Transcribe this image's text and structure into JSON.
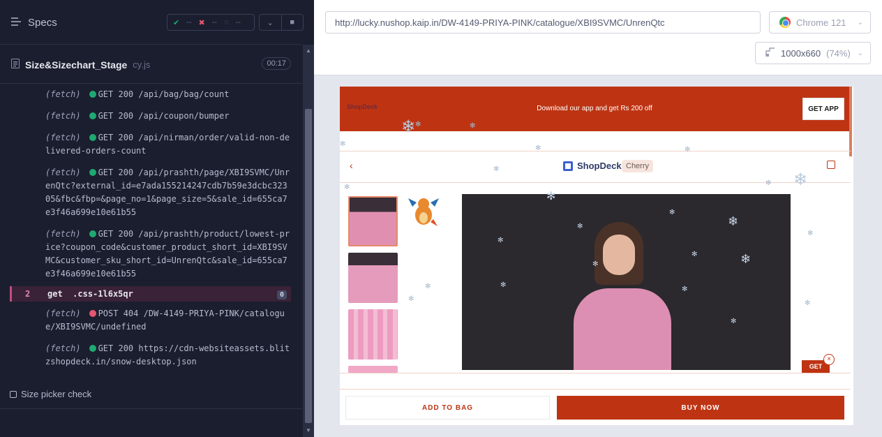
{
  "runner": {
    "specs_label": "Specs",
    "stats": {
      "passed": "--",
      "failed": "--",
      "pending": "--"
    },
    "spec_file": {
      "name": "Size&Sizechart_Stage",
      "ext": "cy.js",
      "duration": "00:17"
    },
    "log": [
      {
        "kind": "(fetch)",
        "status": "green",
        "text": "GET 200 /api/bag/bag/count"
      },
      {
        "kind": "(fetch)",
        "status": "green",
        "text": "GET 200 /api/coupon/bumper"
      },
      {
        "kind": "(fetch)",
        "status": "green",
        "text": "GET 200 /api/nirman/order/valid-non-delivered-orders-count"
      },
      {
        "kind": "(fetch)",
        "status": "green",
        "text": "GET 200 /api/prashth/page/XBI9SVMC/UnrenQtc?external_id=e7ada155214247cdb7b59e3dcbc32305&fbc&fbp=&page_no=1&page_size=5&sale_id=655ca7e3f46a699e10e61b55"
      },
      {
        "kind": "(fetch)",
        "status": "green",
        "text": "GET 200 /api/prashth/product/lowest-price?coupon_code&customer_product_short_id=XBI9SVMC&customer_sku_short_id=UnrenQtc&sale_id=655ca7e3f46a699e10e61b55"
      }
    ],
    "command": {
      "num": "2",
      "name": "get",
      "selector": ".css-1l6x5qr",
      "count": "0"
    },
    "log_after": [
      {
        "kind": "(fetch)",
        "status": "red",
        "text": "POST 404 /DW-4149-PRIYA-PINK/catalogue/XBI9SVMC/undefined"
      },
      {
        "kind": "(fetch)",
        "status": "green",
        "text": "GET 200 https://cdn-websiteassets.blitzshopdeck.in/snow-desktop.json"
      }
    ],
    "next_test": "Size picker check"
  },
  "browser": {
    "url": "http://lucky.nushop.kaip.in/DW-4149-PRIYA-PINK/catalogue/XBI9SVMC/UnrenQtc",
    "name": "Chrome 121",
    "viewport": "1000x660",
    "zoom": "(74%)"
  },
  "app": {
    "banner_logo": "ShopDeck",
    "banner_text": "Download our app and get Rs 200 off",
    "get_app": "GET APP",
    "brand": "ShopDeck",
    "store_pill": "Cherry",
    "float_badge": "GET",
    "add_to_bag": "ADD TO BAG",
    "buy_now": "BUY NOW"
  },
  "colors": {
    "brand": "#be3413",
    "runner_bg": "#1b1e2e",
    "pass": "#1fa971",
    "fail": "#e45770"
  }
}
